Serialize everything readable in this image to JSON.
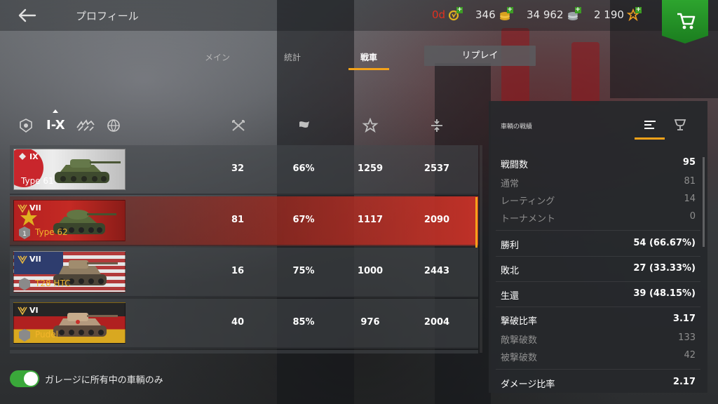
{
  "header": {
    "title": "プロフィール",
    "premium": "0d",
    "gold": "346",
    "credits": "34 962",
    "free_xp": "2 190"
  },
  "tabs": [
    {
      "label": "メイン"
    },
    {
      "label": "統計"
    },
    {
      "label": "戦車",
      "active": true
    }
  ],
  "replay_label": "リプレイ",
  "filter": {
    "tier_label": "I-X"
  },
  "tanks": [
    {
      "tier": "IX",
      "name": "Type 61",
      "battles": "32",
      "winrate": "66%",
      "avg_damage": "1259",
      "avg_xp": "2537",
      "selected": false
    },
    {
      "tier": "VII",
      "name": "Type 62",
      "battles": "81",
      "winrate": "67%",
      "avg_damage": "1117",
      "avg_xp": "2090",
      "selected": true
    },
    {
      "tier": "VII",
      "name": "T28 HTC",
      "battles": "16",
      "winrate": "75%",
      "avg_damage": "1000",
      "avg_xp": "2443",
      "selected": false
    },
    {
      "tier": "VI",
      "name": "Pudel",
      "battles": "40",
      "winrate": "85%",
      "avg_damage": "976",
      "avg_xp": "2004",
      "selected": false
    }
  ],
  "toggle_label": "ガレージに所有中の車輌のみ",
  "panel": {
    "title": "車輌の戦績",
    "battles": {
      "label": "戦闘数",
      "value": "95"
    },
    "regular": {
      "label": "通常",
      "value": "81"
    },
    "rating": {
      "label": "レーティング",
      "value": "14"
    },
    "tournament": {
      "label": "トーナメント",
      "value": "0"
    },
    "victories": {
      "label": "勝利",
      "value": "54 (66.67%)"
    },
    "defeats": {
      "label": "敗北",
      "value": "27 (33.33%)"
    },
    "survived": {
      "label": "生還",
      "value": "39 (48.15%)"
    },
    "kd_ratio": {
      "label": "撃破比率",
      "value": "3.17"
    },
    "destroyed": {
      "label": "敵撃破数",
      "value": "133"
    },
    "deaths": {
      "label": "被撃破数",
      "value": "42"
    },
    "damage_ratio": {
      "label": "ダメージ比率",
      "value": "2.17"
    }
  },
  "colors": {
    "accent": "#f3a21a",
    "selected_row": "#c8322a",
    "shop_green": "#2da42e",
    "premium_red": "#e03020",
    "gold_tank_name": "#f3b52a"
  },
  "icons": [
    "back-arrow-icon",
    "premium-icon",
    "gold-icon",
    "credits-icon",
    "free-xp-icon",
    "cart-icon",
    "mastery-filter-icon",
    "nation-filter-icon",
    "type-filter-icon",
    "battles-icon",
    "winrate-icon",
    "avg-damage-icon",
    "avg-xp-icon",
    "list-view-icon",
    "trophy-icon"
  ]
}
